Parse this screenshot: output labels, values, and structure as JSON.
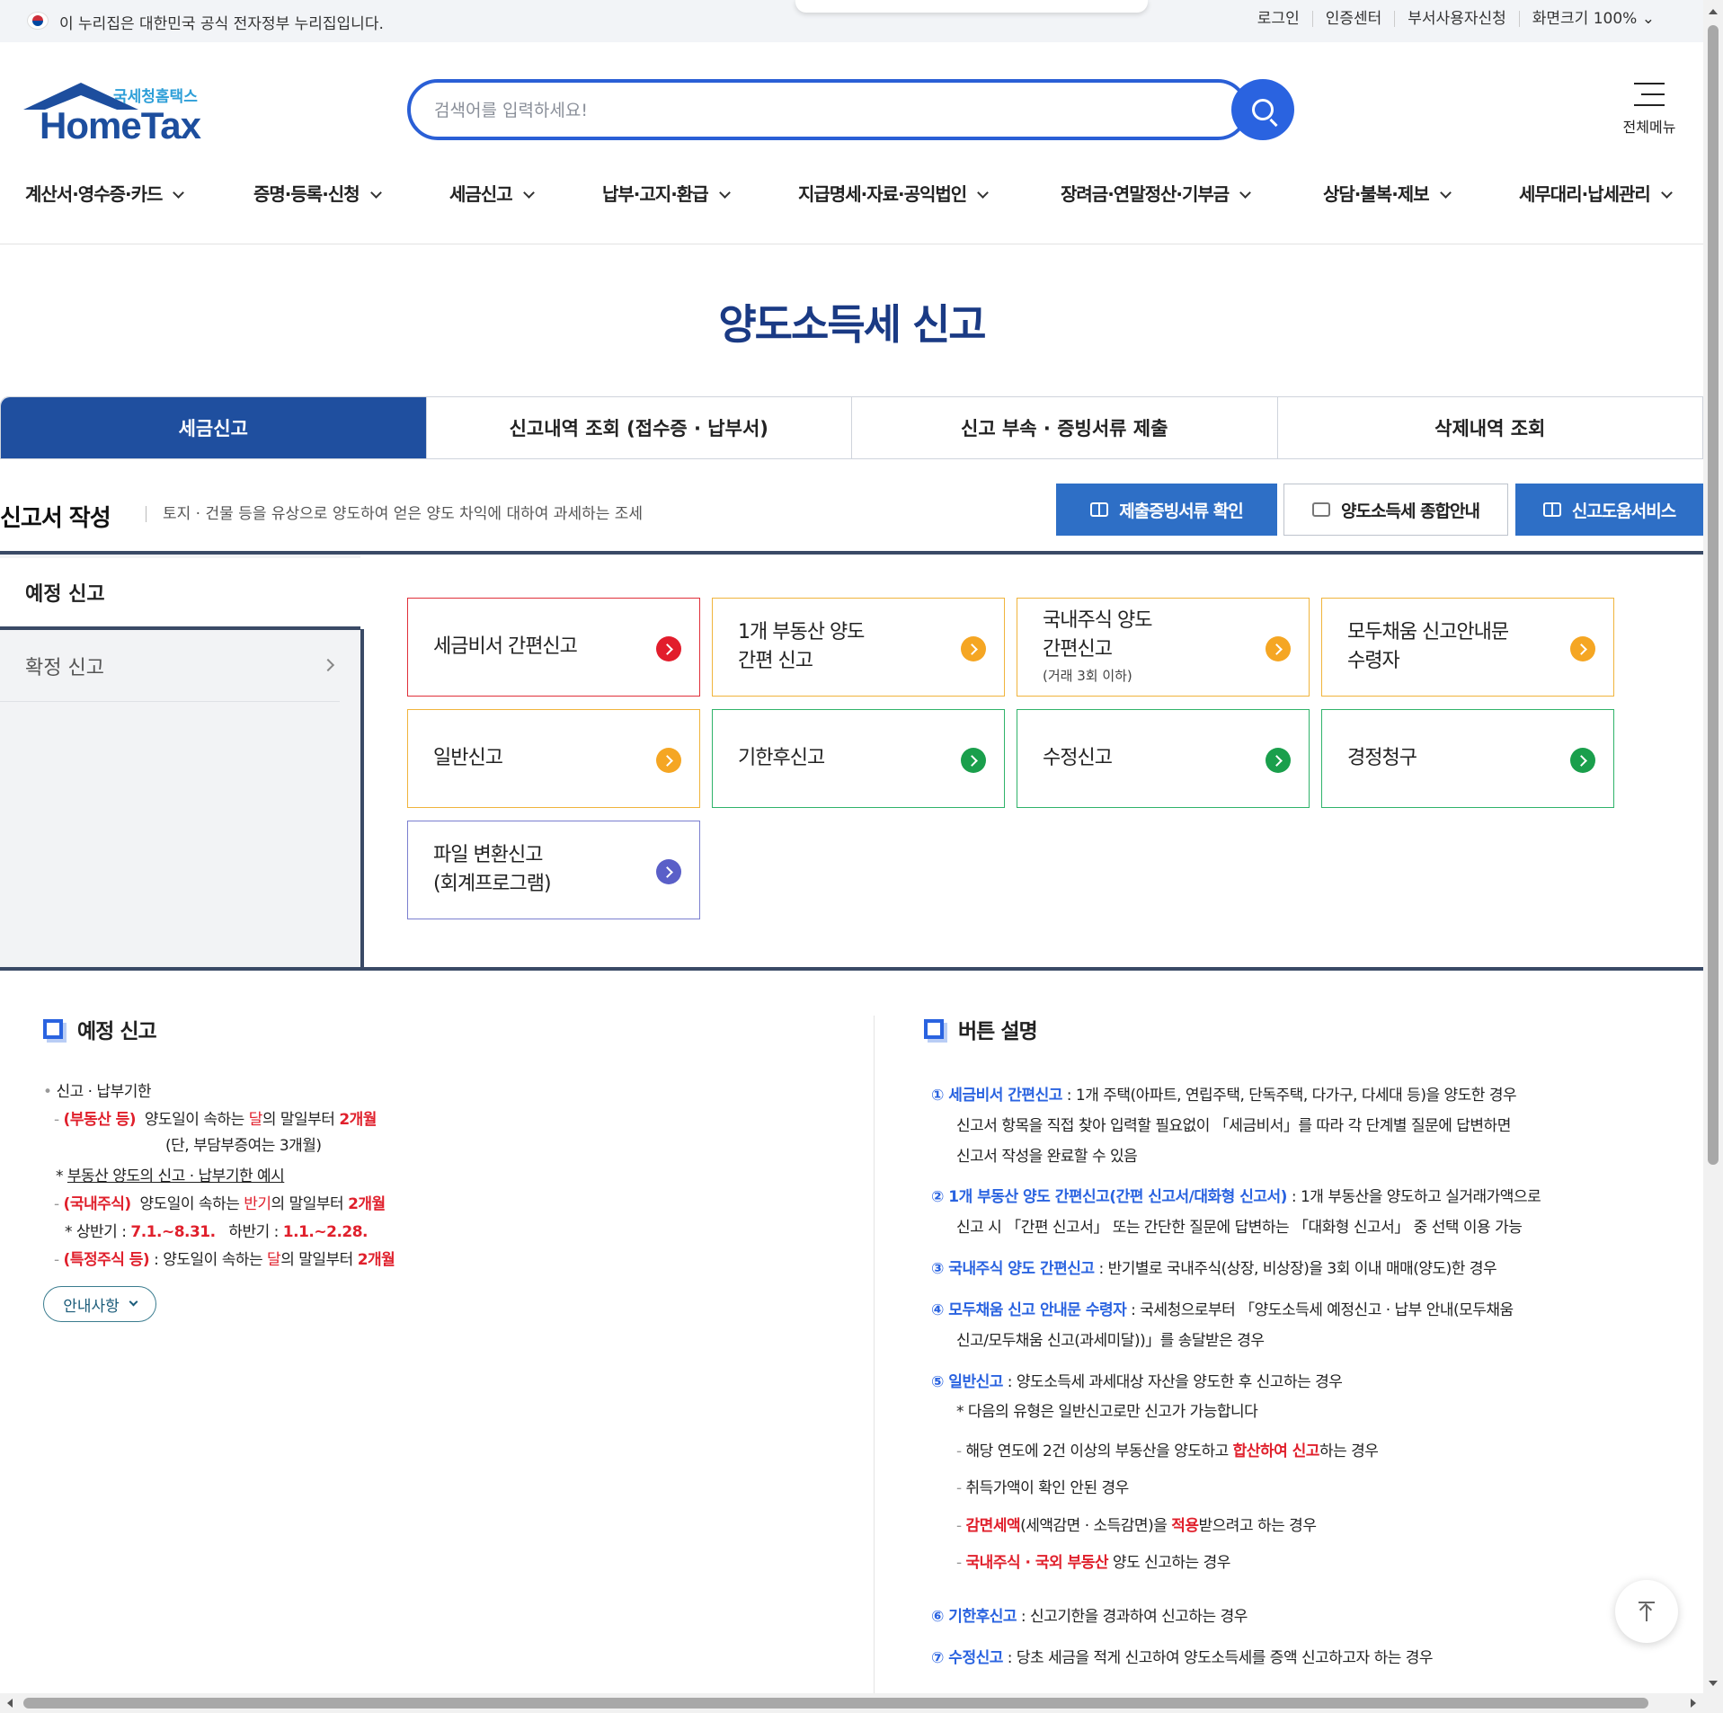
{
  "govbar": {
    "notice": "이 누리집은 대한민국 공식 전자정부 누리집입니다.",
    "utils": [
      "로그인",
      "인증센터",
      "부서사용자신청",
      "화면크기 100%"
    ]
  },
  "logo": {
    "sub": "국세청홈택스",
    "main": "HomeTax"
  },
  "search": {
    "placeholder": "검색어를 입력하세요!"
  },
  "allmenu_label": "전체메뉴",
  "gnb": [
    "계산서·영수증·카드",
    "증명·등록·신청",
    "세금신고",
    "납부·고지·환급",
    "지급명세·자료·공익법인",
    "장려금·연말정산·기부금",
    "상담·불복·제보",
    "세무대리·납세관리"
  ],
  "page_title": "양도소득세 신고",
  "tabs": [
    "세금신고",
    "신고내역 조회 (접수증 · 납부서)",
    "신고 부속 · 증빙서류 제출",
    "삭제내역 조회"
  ],
  "section": {
    "title": "신고서 작성",
    "desc": "토지 · 건물 등을 유상으로 양도하여 얻은 양도 차익에 대하여 과세하는 조세",
    "buttons": [
      "제출증빙서류 확인",
      "양도소득세 종합안내",
      "신고도움서비스"
    ]
  },
  "sidebar": {
    "active": "예정 신고",
    "inactive": "확정 신고"
  },
  "cards": [
    {
      "label": "세금비서 간편신고",
      "color": "red"
    },
    {
      "label": "1개 부동산 양도\n간편 신고",
      "color": "orange"
    },
    {
      "label": "국내주식 양도\n간편신고",
      "small": "(거래 3회 이하)",
      "color": "orange"
    },
    {
      "label": "모두채움 신고안내문\n수령자",
      "color": "orange"
    },
    {
      "label": "일반신고",
      "color": "orange"
    },
    {
      "label": "기한후신고",
      "color": "green"
    },
    {
      "label": "수정신고",
      "color": "green"
    },
    {
      "label": "경정청구",
      "color": "green"
    },
    {
      "label": "파일 변환신고\n(회계프로그램)",
      "color": "purple"
    }
  ],
  "left_info": {
    "heading": "예정 신고",
    "deadline_label": "신고 · 납부기한",
    "re1_tag": "(부동산  등)",
    "re1_a": "양도일이 속하는 ",
    "re1_b": "달",
    "re1_c": "의 말일부터 ",
    "re1_d": "2개월",
    "re1_note": "(단, 부담부증여는 3개월)",
    "example": "부동산 양도의 신고 · 납부기한 예시",
    "st_tag": "(국내주식)",
    "st_a": "양도일이 속하는 ",
    "st_b": "반기",
    "st_c": "의 말일부터 ",
    "st_d": "2개월",
    "half1": "상반기 : ",
    "half1_v": "7.1.~8.31.",
    "half2": "하반기 : ",
    "half2_v": "1.1.~2.28.",
    "sp_tag": "(특정주식 등)",
    "sp_a": " : 양도일이 속하는 ",
    "sp_b": "달",
    "sp_c": "의 말일부터 ",
    "sp_d": "2개월",
    "guide_button": "안내사항"
  },
  "right_info": {
    "heading": "버튼 설명",
    "i1_title": "① 세금비서 간편신고",
    "i1_l1": " : 1개 주택(아파트, 연립주택, 단독주택, 다가구, 다세대 등)을 양도한 경우",
    "i1_l2": "신고서 항목을 직접 찾아 입력할 필요없이 「세금비서」를 따라 각 단계별 질문에 답변하면",
    "i1_l3": "신고서 작성을 완료할 수 있음",
    "i2_title": "② 1개 부동산 양도 간편신고(간편 신고서/대화형 신고서)",
    "i2_l1": " : 1개 부동산을 양도하고 실거래가액으로",
    "i2_l2": "신고 시 「간편 신고서」 또는 간단한 질문에 답변하는 「대화형 신고서」 중 선택 이용 가능",
    "i3_title": "③ 국내주식 양도 간편신고",
    "i3_l1": " : 반기별로 국내주식(상장, 비상장)을 3회 이내 매매(양도)한 경우",
    "i4_title": "④ 모두채움 신고 안내문 수령자",
    "i4_l1": " : 국세청으로부터 「양도소득세 예정신고 · 납부 안내(모두채움",
    "i4_l2": "신고/모두채움 신고(과세미달))」를 송달받은 경우",
    "i5_title": "⑤ 일반신고",
    "i5_l1": " : 양도소득세 과세대상 자산을 양도한 후 신고하는 경우",
    "i5_note": "다음의 유형은 일반신고로만 신고가 가능합니다",
    "i5_s1a": "해당 연도에 2건 이상의 부동산을 양도하고 ",
    "i5_s1b": "합산하여 신고",
    "i5_s1c": "하는 경우",
    "i5_s2": "취득가액이 확인 안된 경우",
    "i5_s3a": "감면세액",
    "i5_s3b": "(세액감면 · 소득감면)을 ",
    "i5_s3c": "적용",
    "i5_s3d": "받으려고 하는 경우",
    "i5_s4a": "국내주식 · 국외 부동산",
    "i5_s4b": " 양도 신고하는 경우",
    "i6_title": "⑥ 기한후신고",
    "i6_l1": " : 신고기한을 경과하여 신고하는 경우",
    "i7_title": "⑦ 수정신고",
    "i7_l1": " : 당초 세금을 적게 신고하여 양도소득세를 증액 신고하고자 하는 경우"
  }
}
